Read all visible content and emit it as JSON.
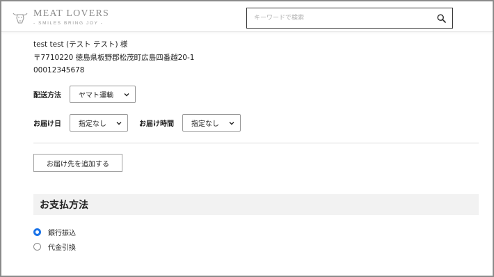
{
  "header": {
    "logo_title": "MEAT LOVERS",
    "logo_subtitle": "- SMILES BRING JOY -",
    "search_placeholder": "キーワードで検索"
  },
  "address": {
    "name": "test test (テスト テスト) 様",
    "address_line": "〒7710220 徳島県板野郡松茂町広島四番越20-1",
    "phone": "00012345678"
  },
  "delivery": {
    "method_label": "配送方法",
    "method_value": "ヤマト運輸",
    "date_label": "お届け日",
    "date_value": "指定なし",
    "time_label": "お届け時間",
    "time_value": "指定なし",
    "add_destination_label": "お届け先を追加する"
  },
  "payment": {
    "section_title": "お支払方法",
    "options": [
      {
        "label": "銀行振込",
        "checked": true
      },
      {
        "label": "代金引換",
        "checked": false
      }
    ]
  },
  "colors": {
    "accent": "#1a73e8",
    "section_bg": "#f2f2f2"
  }
}
